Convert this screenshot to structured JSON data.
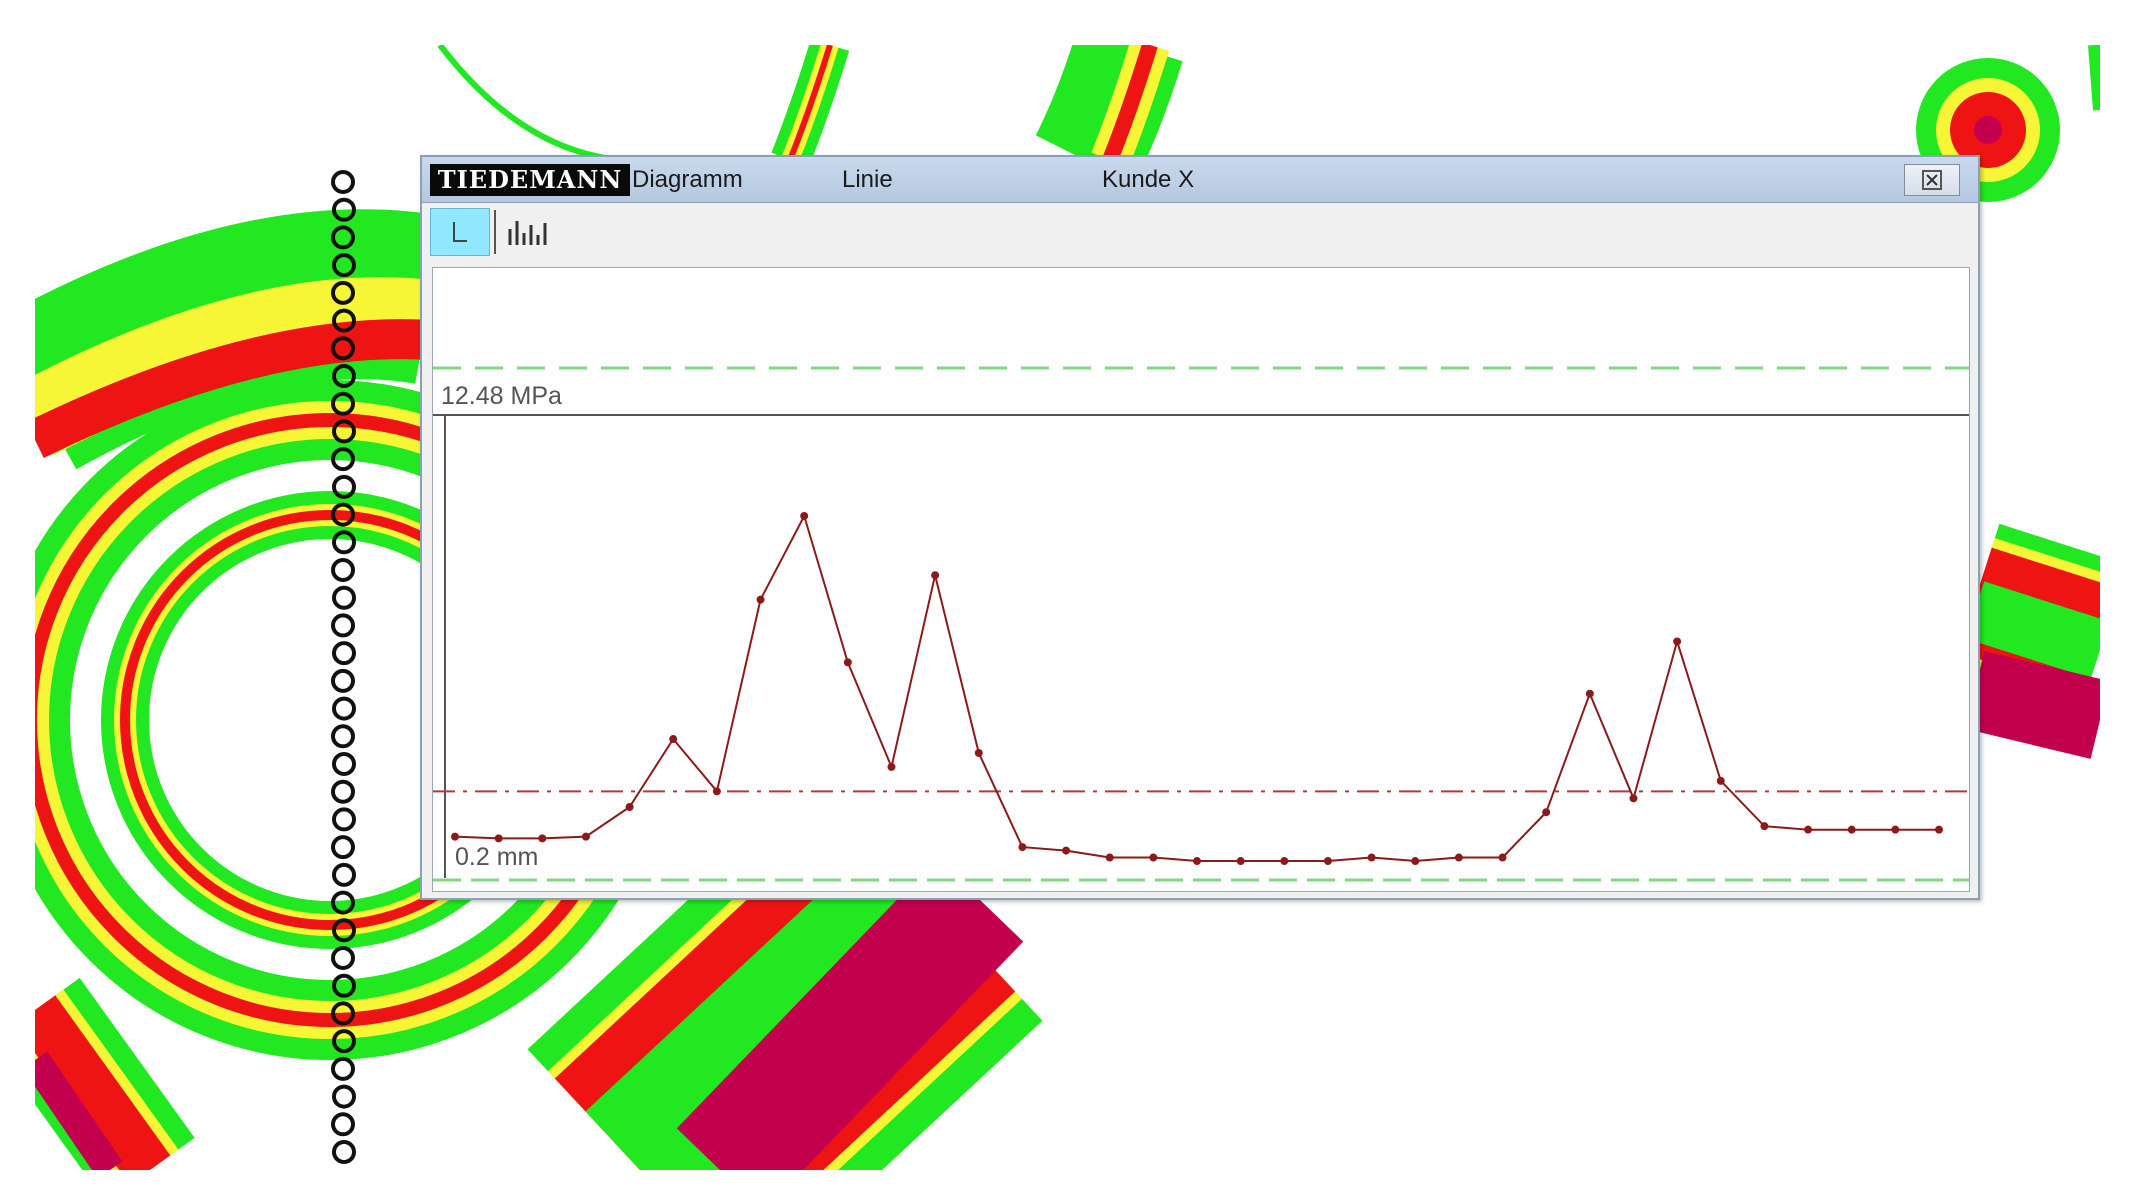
{
  "window": {
    "logo": "TIEDEMANN",
    "menu": [
      "Diagramm",
      "Linie",
      "Kunde X"
    ],
    "close_icon": "close-box-icon"
  },
  "toolbar": {
    "buttons": [
      {
        "icon": "line-chart-icon",
        "active": true
      },
      {
        "icon": "bar-chart-icon",
        "active": false
      }
    ]
  },
  "chart": {
    "max_label": "12.48 MPa",
    "min_label": "0.2 mm",
    "colors": {
      "line": "#8b1a1a",
      "threshold": "#b33a3a",
      "limit": "#7ed87e"
    }
  },
  "chart_data": {
    "type": "line",
    "title": "",
    "xlabel": "",
    "ylabel": "",
    "ylim": [
      0,
      12.48
    ],
    "series": [
      {
        "values": [
          0.9,
          0.85,
          0.85,
          0.9,
          1.75,
          3.7,
          2.2,
          7.7,
          10.1,
          5.9,
          2.9,
          8.4,
          3.3,
          0.6,
          0.5,
          0.3,
          0.3,
          0.2,
          0.2,
          0.2,
          0.2,
          0.3,
          0.2,
          0.3,
          0.3,
          1.6,
          5.0,
          2.0,
          6.5,
          2.5,
          1.2,
          1.1,
          1.1,
          1.1,
          1.1
        ]
      }
    ],
    "threshold": 2.2,
    "grid": false
  },
  "background": {
    "colors": {
      "outer": "#22e822",
      "mid": "#f6f637",
      "hot": "#ee1414",
      "core": "#c2004e"
    }
  }
}
